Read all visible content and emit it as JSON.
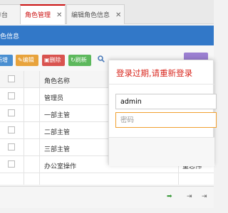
{
  "tabs": [
    {
      "label": "作台",
      "active": false
    },
    {
      "label": "角色管理",
      "active": true,
      "close": "✕"
    },
    {
      "label": "编辑角色信息",
      "active": false,
      "close": "✕"
    }
  ],
  "titlebar": {
    "title": "色信息"
  },
  "toolbar": {
    "buttons": [
      {
        "label": "新增"
      },
      {
        "label": "编辑"
      },
      {
        "label": "删除"
      },
      {
        "label": "刷新"
      }
    ]
  },
  "grid": {
    "header": [
      "角色名称"
    ],
    "rows": [
      {
        "name": "管理员",
        "extra": ""
      },
      {
        "name": "一部主管",
        "extra": ""
      },
      {
        "name": "二部主管",
        "extra": ""
      },
      {
        "name": "三部主管",
        "extra": ""
      },
      {
        "name": "办公室操作",
        "extra": "董志伟"
      }
    ]
  },
  "login_modal": {
    "title": "登录过期,请重新登录",
    "username_value": "admin",
    "username_placeholder": "",
    "password_value": "",
    "password_placeholder": "密码"
  },
  "colors": {
    "accent_red": "#d9281f",
    "titlebar_blue": "#3278c8",
    "focus_orange": "#f0a030"
  }
}
